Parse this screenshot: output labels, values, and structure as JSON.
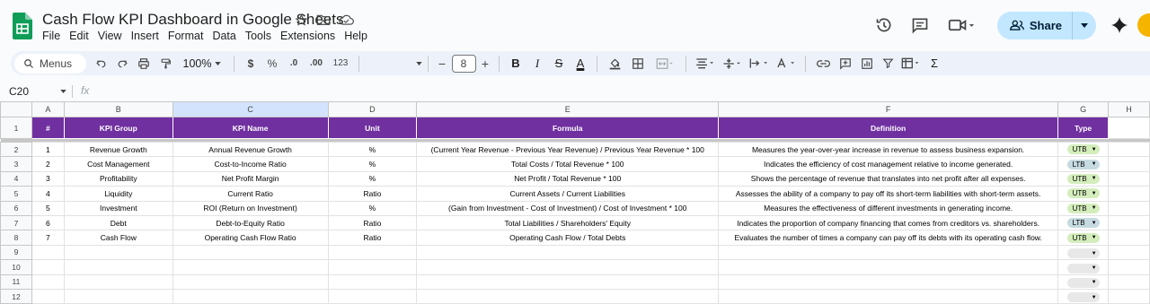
{
  "title": "Cash Flow KPI Dashboard in Google Sheets",
  "menu": [
    "File",
    "Edit",
    "View",
    "Insert",
    "Format",
    "Data",
    "Tools",
    "Extensions",
    "Help"
  ],
  "share_label": "Share",
  "toolbar": {
    "search_label": "Menus",
    "zoom": "100%",
    "currency": "$",
    "percent": "%",
    "dec_decrease": ".0",
    "dec_increase": ".00",
    "number_format": "123",
    "font_size": "8",
    "font_size_minus": "−",
    "font_size_plus": "+",
    "bold": "B",
    "italic": "I",
    "strike": "S",
    "text_color": "A",
    "sum": "Σ"
  },
  "name_box": "C20",
  "fx": "fx",
  "columns": [
    "A",
    "B",
    "C",
    "D",
    "E",
    "F",
    "G",
    "H"
  ],
  "headers": [
    "#",
    "KPI Group",
    "KPI Name",
    "Unit",
    "Formula",
    "Definition",
    "Type"
  ],
  "rows": [
    {
      "n": "1",
      "group": "Revenue Growth",
      "name": "Annual Revenue Growth",
      "unit": "%",
      "formula": "(Current Year Revenue - Previous Year Revenue) / Previous Year Revenue * 100",
      "definition": "Measures the year-over-year increase in revenue to assess business expansion.",
      "type": "UTB",
      "type_color": "#d4edbc"
    },
    {
      "n": "2",
      "group": "Cost Management",
      "name": "Cost-to-Income Ratio",
      "unit": "%",
      "formula": "Total Costs / Total Revenue * 100",
      "definition": "Indicates the efficiency of cost management relative to income generated.",
      "type": "LTB",
      "type_color": "#c6dbe1"
    },
    {
      "n": "3",
      "group": "Profitability",
      "name": "Net Profit Margin",
      "unit": "%",
      "formula": "Net Profit / Total Revenue * 100",
      "definition": "Shows the percentage of revenue that translates into net profit after all expenses.",
      "type": "UTB",
      "type_color": "#d4edbc"
    },
    {
      "n": "4",
      "group": "Liquidity",
      "name": "Current Ratio",
      "unit": "Ratio",
      "formula": "Current Assets / Current Liabilities",
      "definition": "Assesses the ability of a company to pay off its short-term liabilities with short-term assets.",
      "type": "UTB",
      "type_color": "#d4edbc"
    },
    {
      "n": "5",
      "group": "Investment",
      "name": "ROI (Return on Investment)",
      "unit": "%",
      "formula": "(Gain from Investment - Cost of Investment) / Cost of Investment * 100",
      "definition": "Measures the effectiveness of different investments in generating income.",
      "type": "UTB",
      "type_color": "#d4edbc"
    },
    {
      "n": "6",
      "group": "Debt",
      "name": "Debt-to-Equity Ratio",
      "unit": "Ratio",
      "formula": "Total Liabilities / Shareholders' Equity",
      "definition": "Indicates the proportion of company financing that comes from creditors vs. shareholders.",
      "type": "LTB",
      "type_color": "#c6dbe1"
    },
    {
      "n": "7",
      "group": "Cash Flow",
      "name": "Operating Cash Flow Ratio",
      "unit": "Ratio",
      "formula": "Operating Cash Flow / Total Debts",
      "definition": "Evaluates the number of times a company can pay off its debts with its operating cash flow.",
      "type": "UTB",
      "type_color": "#d4edbc"
    }
  ],
  "empty_rows": [
    "9",
    "10",
    "11",
    "12"
  ],
  "row_numbers": [
    "1",
    "2",
    "3",
    "4",
    "5",
    "6",
    "7",
    "8"
  ],
  "colors": {
    "header_bg": "#7030a0",
    "share_bg": "#c2e7ff",
    "toolbar_bg": "#edf2fa",
    "selected_col": "#d3e3fd"
  }
}
